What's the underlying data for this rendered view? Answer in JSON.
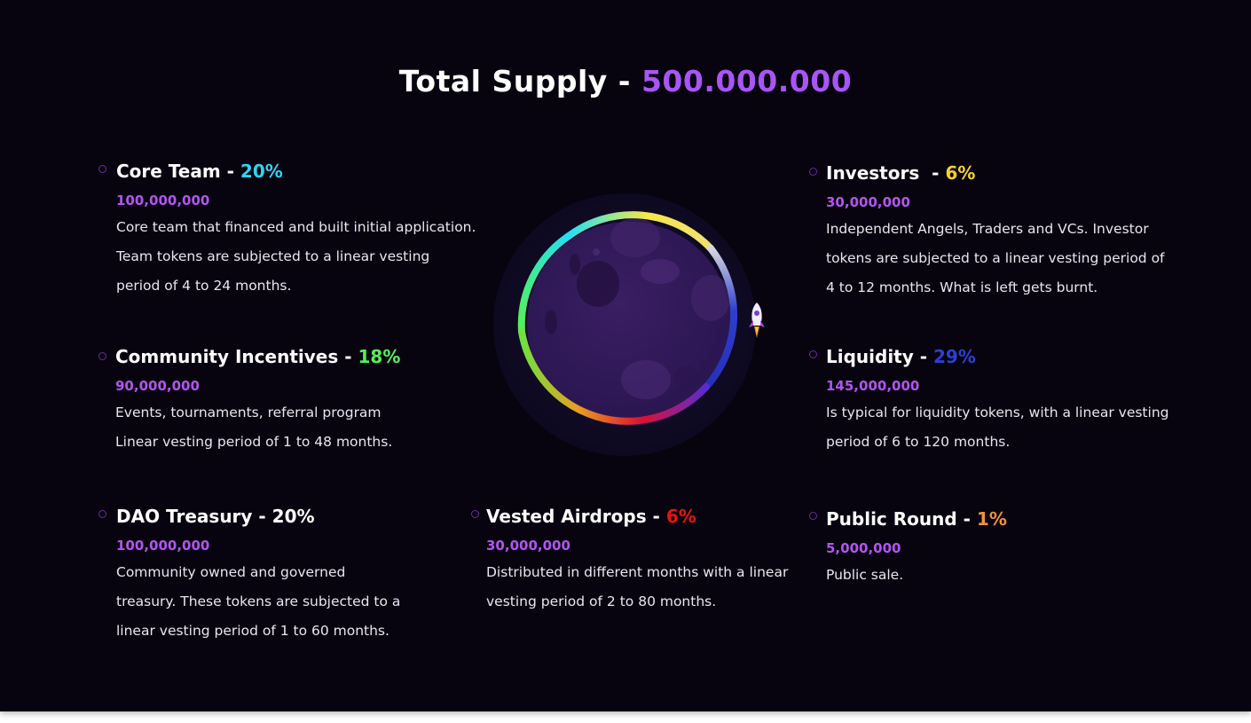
{
  "title": {
    "prefix": "Total Supply - ",
    "value": "500.000.000"
  },
  "colors": {
    "background": "#07040f",
    "title_accent": "#a855f7",
    "amount": "#b354f0",
    "core_team": "#2fd4f5",
    "community": "#55f05a",
    "investors": "#f5d22a",
    "liquidity": "#2b3fd6",
    "airdrops": "#e8120f",
    "public_round": "#f0923a"
  },
  "allocations": {
    "core_team": {
      "label": "Core Team - ",
      "percent": "20%",
      "amount": "100,000,000",
      "lines": [
        "Core team that financed and built initial application.",
        "Team tokens are subjected to a linear vesting",
        "period of 4 to 24 months."
      ]
    },
    "community": {
      "label": "Community Incentives - ",
      "percent": "18%",
      "amount": "90,000,000",
      "lines": [
        "Events, tournaments, referral program",
        "Linear vesting period of 1 to 48 months."
      ]
    },
    "dao": {
      "label": "DAO Treasury - 20%",
      "amount": "100,000,000",
      "lines": [
        "Community owned and governed",
        "treasury. These tokens are subjected to a",
        "linear vesting period of 1 to 60 months."
      ]
    },
    "airdrops": {
      "label": "Vested Airdrops - ",
      "percent": "6%",
      "amount": "30,000,000",
      "lines": [
        "Distributed in different months with a linear",
        "vesting period of 2 to 80 months."
      ]
    },
    "investors": {
      "label": "Investors  - ",
      "percent": "6%",
      "amount": "30,000,000",
      "lines": [
        "Independent Angels, Traders and VCs. Investor",
        "tokens are subjected to a linear vesting period of",
        "4 to 12 months. What is left gets burnt."
      ]
    },
    "liquidity": {
      "label": "Liquidity - ",
      "percent": "29%",
      "amount": "145,000,000",
      "lines": [
        "Is typical for liquidity tokens, with a linear vesting",
        "period of 6 to 120 months."
      ]
    },
    "public_round": {
      "label": "Public Round - ",
      "percent": "1%",
      "amount": "5,000,000",
      "lines": [
        "Public sale."
      ]
    }
  },
  "icons": {
    "planet": "planet-icon",
    "rocket": "rocket-icon",
    "bullet": "circle-bullet-icon"
  }
}
